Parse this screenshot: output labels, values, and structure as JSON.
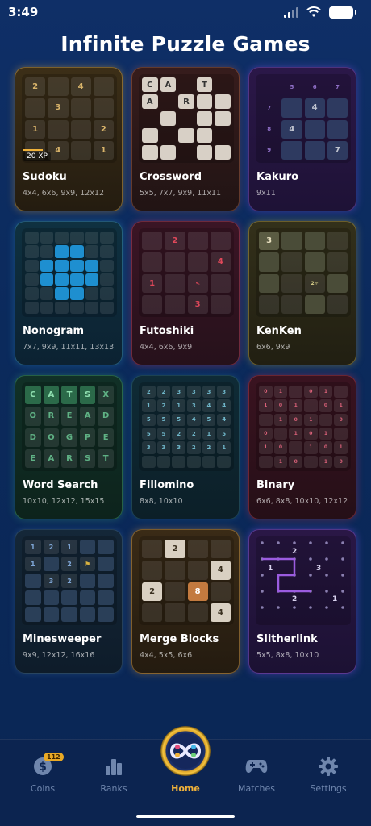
{
  "status": {
    "time": "3:49"
  },
  "title": "Infinite Puzzle Games",
  "games": [
    {
      "name": "Sudoku",
      "sizes": "4x4, 6x6, 9x9, 12x12",
      "badge": "20 XP"
    },
    {
      "name": "Crossword",
      "sizes": "5x5, 7x7, 9x9, 11x11"
    },
    {
      "name": "Kakuro",
      "sizes": "9x11"
    },
    {
      "name": "Nonogram",
      "sizes": "7x7, 9x9, 11x11, 13x13"
    },
    {
      "name": "Futoshiki",
      "sizes": "4x4, 6x6, 9x9"
    },
    {
      "name": "KenKen",
      "sizes": "6x6, 9x9"
    },
    {
      "name": "Word Search",
      "sizes": "10x10, 12x12, 15x15"
    },
    {
      "name": "Fillomino",
      "sizes": "8x8, 10x10"
    },
    {
      "name": "Binary",
      "sizes": "6x6, 8x8, 10x10, 12x12"
    },
    {
      "name": "Minesweeper",
      "sizes": "9x9, 12x12, 16x16"
    },
    {
      "name": "Merge Blocks",
      "sizes": "4x4, 5x5, 6x6"
    },
    {
      "name": "Slitherlink",
      "sizes": "5x5, 8x8, 10x10"
    }
  ],
  "tabs": {
    "coins": {
      "label": "Coins",
      "badge": "112",
      "icon": "dollar-coin-icon"
    },
    "ranks": {
      "label": "Ranks",
      "icon": "bar-chart-icon"
    },
    "home": {
      "label": "Home",
      "icon": "infinity-puzzle-logo"
    },
    "matches": {
      "label": "Matches",
      "icon": "gamepad-icon"
    },
    "settings": {
      "label": "Settings",
      "icon": "gear-icon"
    }
  },
  "colors": {
    "accent": "#f0b23a",
    "tab_inactive": "#6f86ad",
    "background": "#0b2a5c"
  }
}
